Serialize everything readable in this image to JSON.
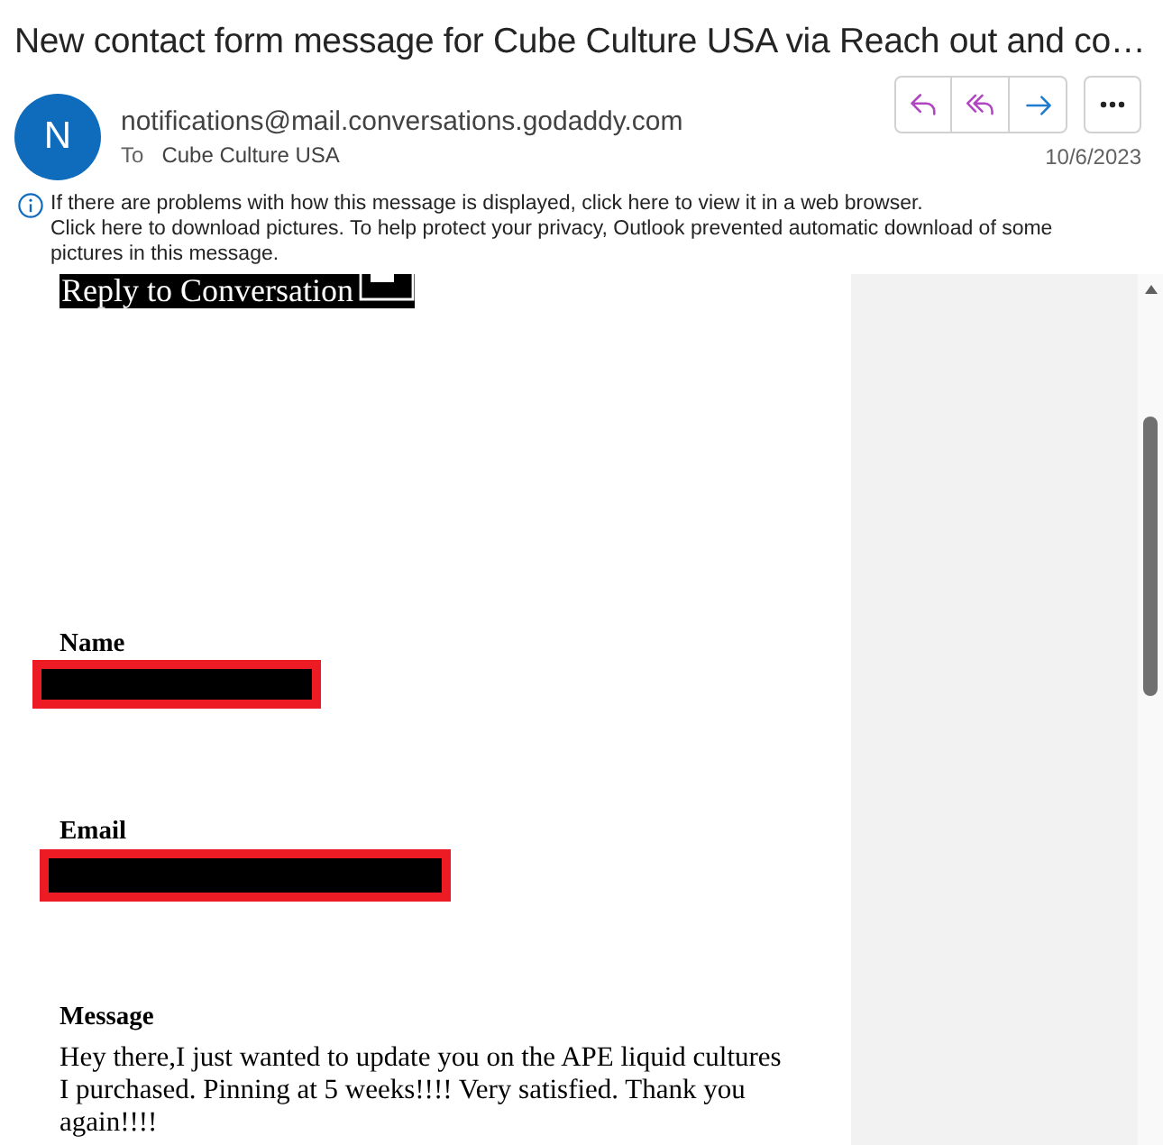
{
  "message": {
    "subject": "New contact form message for Cube Culture USA via Reach out and co…",
    "sender": {
      "initial": "N",
      "address": "notifications@mail.conversations.godaddy.com"
    },
    "recipients": {
      "label": "To",
      "names": [
        "Cube Culture USA"
      ]
    },
    "date": "10/6/2023"
  },
  "info_bar": {
    "lines": [
      "If there are problems with how this message is displayed, click here to view it in a web browser.",
      "Click here to download pictures. To help protect your privacy, Outlook prevented automatic download of some pictures in this message."
    ]
  },
  "body": {
    "banner": {
      "label": "Reply to Conversation"
    },
    "fields": [
      {
        "label": "Name",
        "redacted": true
      },
      {
        "label": "Email",
        "redacted": true
      },
      {
        "label": "Message",
        "redacted": false,
        "value": "Hey there,I just wanted to update you on the APE liquid cultures I purchased. Pinning at 5 weeks!!!! Very satisfied. Thank you again!!!!"
      }
    ]
  }
}
